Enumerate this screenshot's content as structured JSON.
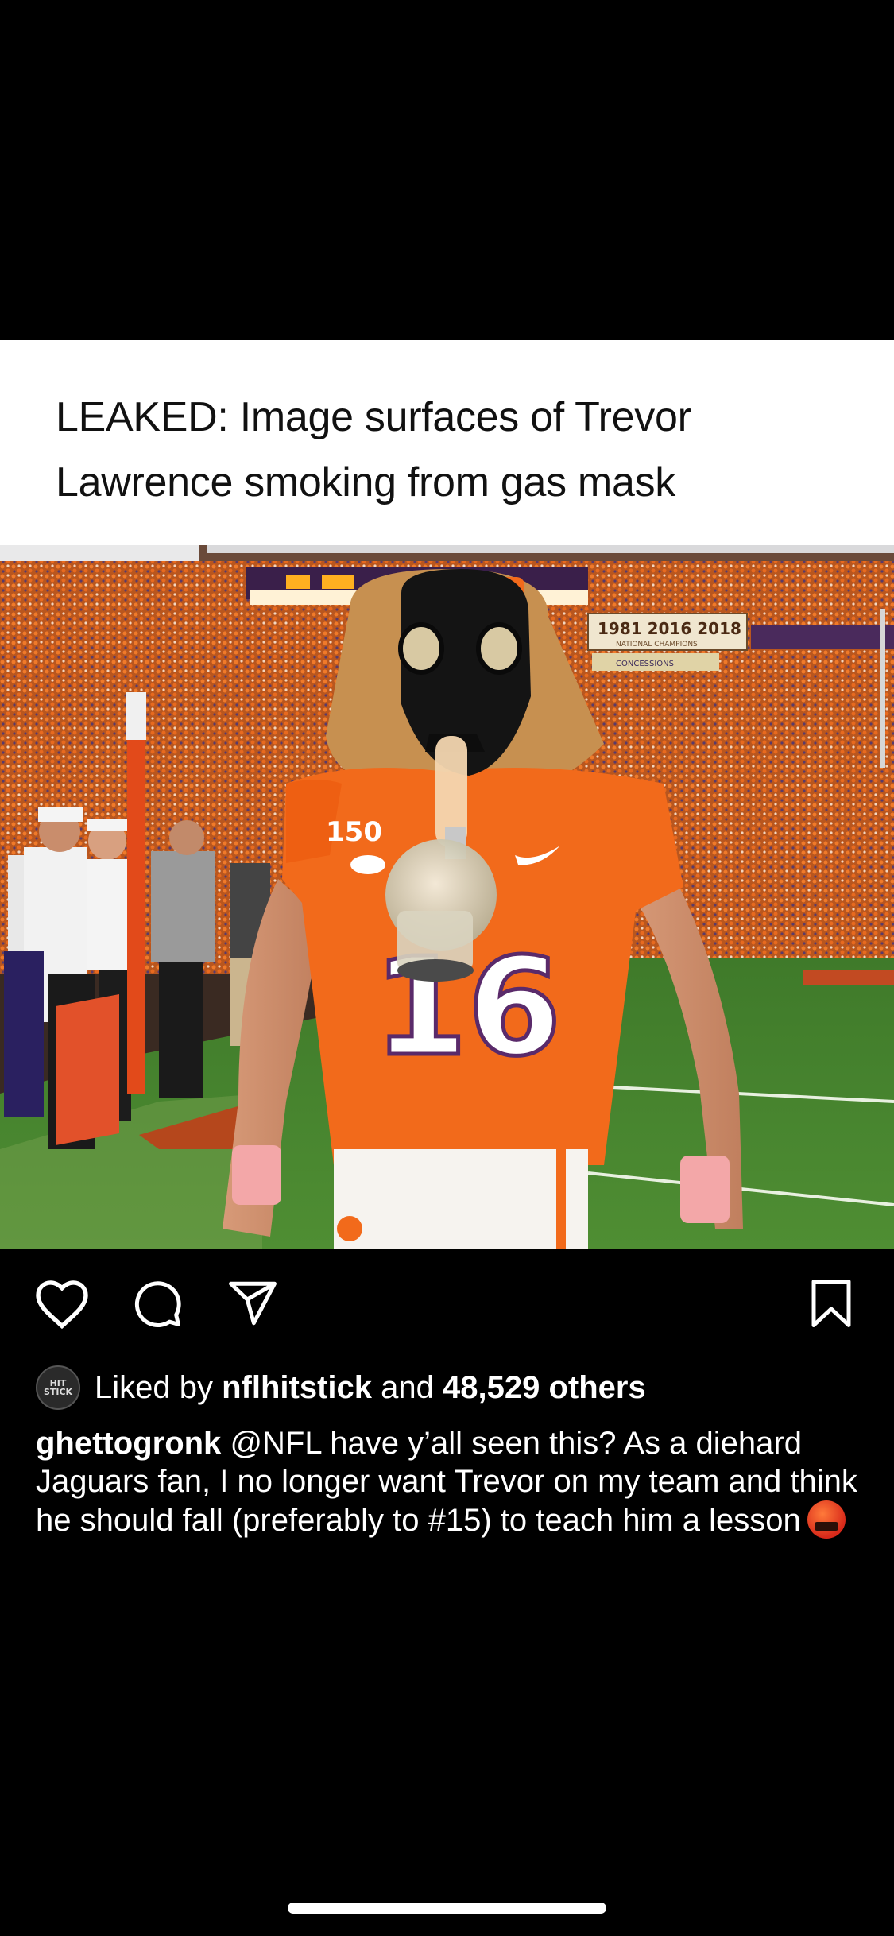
{
  "post": {
    "headline": "LEAKED: Image surfaces of Trevor Lawrence smoking from gas mask",
    "photo": {
      "scoreboard_years": "1981  2016  2018",
      "scoreboard_sub": "NATIONAL CHAMPIONS",
      "concessions": "CONCESSIONS",
      "jersey_number": "16",
      "patch": "150"
    }
  },
  "actions": {
    "like_icon": "heart-icon",
    "comment_icon": "comment-icon",
    "share_icon": "paper-plane-icon",
    "save_icon": "bookmark-icon"
  },
  "likes": {
    "avatar_text": "HIT STICK",
    "liked_by": "Liked by",
    "first_liker": "nflhitstick",
    "and": "and",
    "others": "48,529 others"
  },
  "caption": {
    "username": "ghettogronk",
    "text": "@NFL have y’all seen this? As a diehard Jaguars fan, I no longer want Trevor on my team and think he should fall (preferably to #15) to teach him a lesson",
    "emoji": "face-with-symbols-emoji"
  },
  "colors": {
    "background": "#000000",
    "text": "#ffffff",
    "headline_panel": "#ffffff",
    "jersey_orange": "#F56600"
  }
}
